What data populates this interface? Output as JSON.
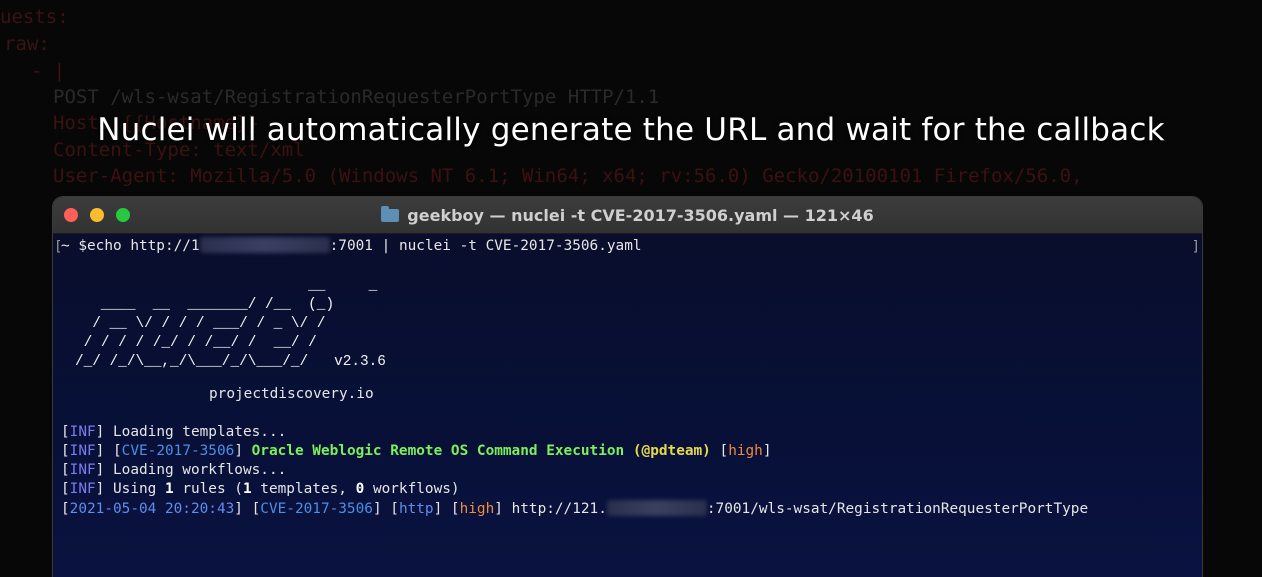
{
  "background_editor": {
    "lines": [
      {
        "text": "uests:",
        "class": "bg-key"
      },
      {
        "text": "raw:",
        "class": "bg-key"
      },
      {
        "text": "  - |",
        "class": "bg-dash"
      },
      {
        "text": "POST /wls-wsat/RegistrationRequesterPortType HTTP/1.1",
        "class": "bg-str"
      },
      {
        "text": "Host: {{Hostname}}",
        "class": "bg-red"
      },
      {
        "text": "Content-Type: text/xml",
        "class": "bg-red"
      },
      {
        "text": "User-Agent: Mozilla/5.0 (Windows NT 6.1; Win64; x64; rv:56.0) Gecko/20100101 Firefox/56.0,",
        "class": "bg-red"
      }
    ]
  },
  "subtitle": "Nuclei will automatically generate the URL and wait for the callback",
  "window": {
    "title": "geekboy — nuclei -t CVE-2017-3506.yaml — 121×46",
    "traffic_lights": [
      "close",
      "minimize",
      "zoom"
    ]
  },
  "terminal": {
    "bracket_left": "[",
    "bracket_right": "]",
    "command": {
      "prompt": "~ $",
      "pre": "echo http://1",
      "post": ":7001 | nuclei -t CVE-2017-3506.yaml"
    },
    "banner": {
      "ascii_art": "                           __     _\n   ____  __  _______/ /__  (_)\n  / __ \\/ / / / ___/ / _ \\/ /\n / / / / /_/ / /__/ /  __/ /\n/_/ /_/\\__,_/\\___/_/\\___/_/   v2.3.6",
      "website": "projectdiscovery.io"
    },
    "log": {
      "l1": {
        "tag": "INF",
        "text": "Loading templates..."
      },
      "l2": {
        "tag": "INF",
        "cve": "CVE-2017-3506",
        "name": "Oracle Weblogic Remote OS Command Execution",
        "author": "(@pdteam)",
        "severity": "high"
      },
      "l3": {
        "tag": "INF",
        "text": "Loading workflows..."
      },
      "l4": {
        "tag": "INF",
        "pre": "Using ",
        "rules": "1",
        "mid": " rules (",
        "templates": "1",
        "mid2": " templates, ",
        "workflows": "0",
        "post": " workflows)"
      },
      "l5": {
        "timestamp": "2021-05-04 20:20:43",
        "cve": "CVE-2017-3506",
        "protocol": "http",
        "severity": "high",
        "url_pre": "http://121.",
        "url_post": ":7001/wls-wsat/RegistrationRequesterPortType"
      }
    }
  },
  "colors": {
    "inf": "#7b7cf0",
    "cve": "#4c8fe6",
    "template_name": "#7cf05a",
    "author": "#e6d94a",
    "severity": "#f08a3c"
  }
}
